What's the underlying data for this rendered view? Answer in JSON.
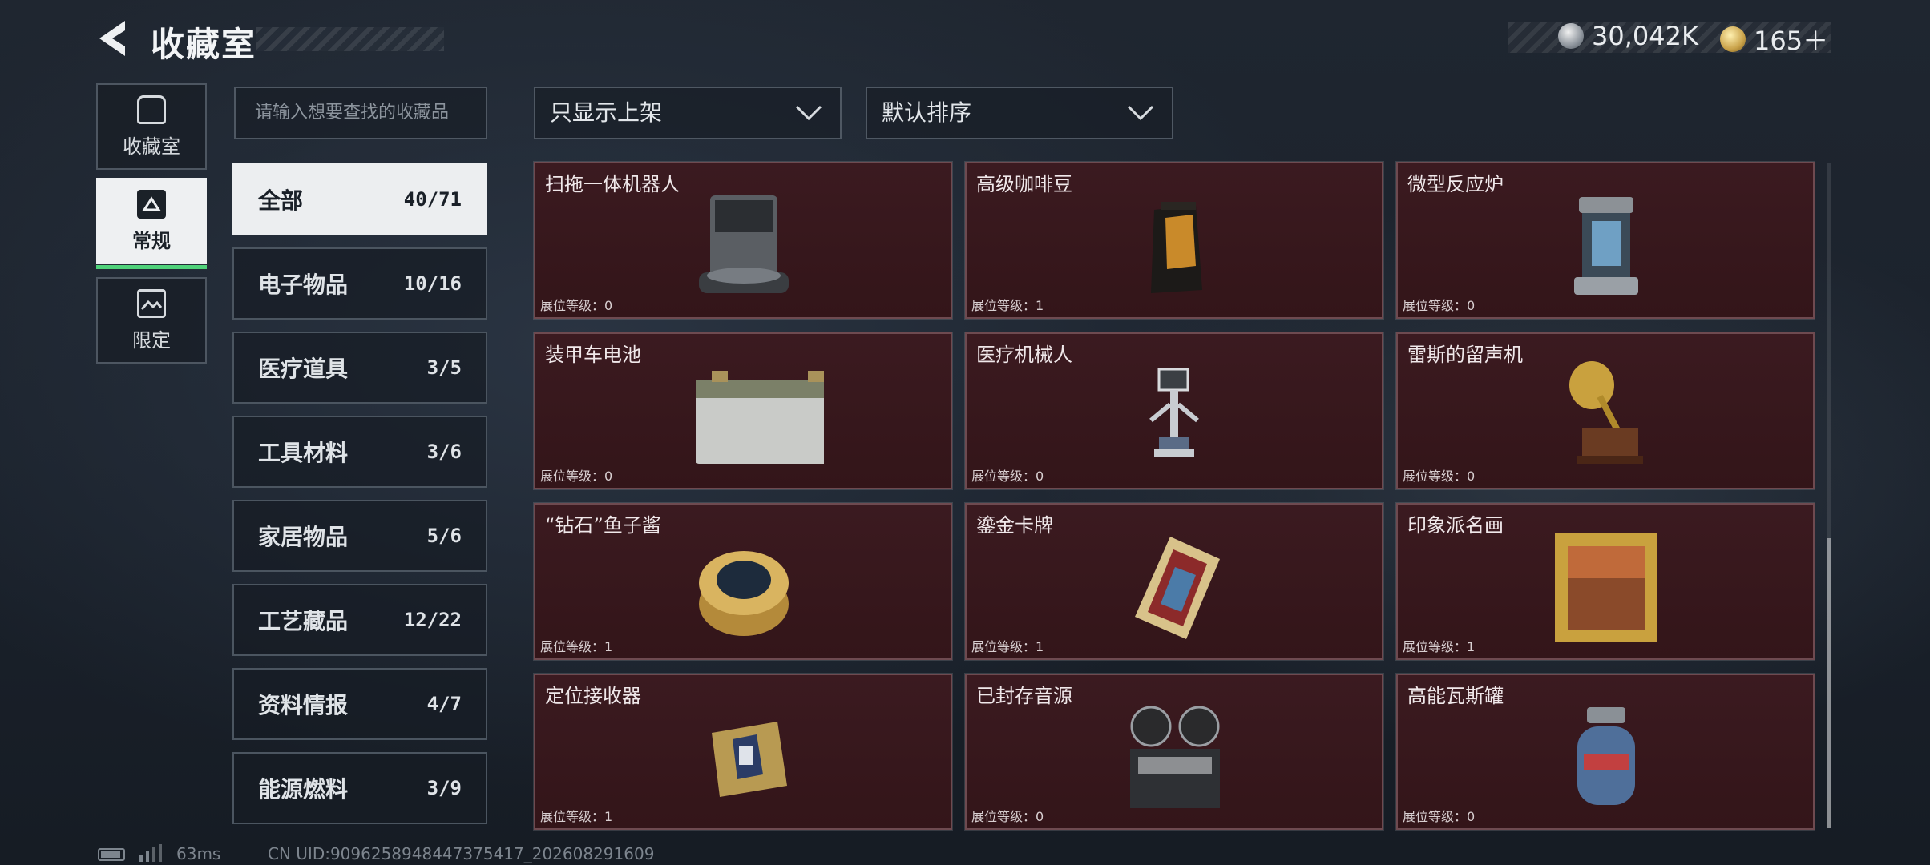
{
  "header": {
    "title": "收藏室",
    "currencies": [
      {
        "icon": "silver-coin-icon",
        "value": "30,042K"
      },
      {
        "icon": "gold-coin-icon",
        "value": "165＋"
      }
    ]
  },
  "side_tabs": [
    {
      "label": "收藏室",
      "icon": "vault-icon",
      "active": false
    },
    {
      "label": "常规",
      "icon": "document-icon",
      "active": true
    },
    {
      "label": "限定",
      "icon": "picture-icon",
      "active": false
    }
  ],
  "search": {
    "placeholder": "请输入想要查找的收藏品"
  },
  "categories": [
    {
      "name": "全部",
      "count": "40/71",
      "active": true
    },
    {
      "name": "电子物品",
      "count": "10/16"
    },
    {
      "name": "医疗道具",
      "count": "3/5"
    },
    {
      "name": "工具材料",
      "count": "3/6"
    },
    {
      "name": "家居物品",
      "count": "5/6"
    },
    {
      "name": "工艺藏品",
      "count": "12/22"
    },
    {
      "name": "资料情报",
      "count": "4/7"
    },
    {
      "name": "能源燃料",
      "count": "3/9"
    }
  ],
  "filters": {
    "filter_label": "只显示上架",
    "sort_label": "默认排序"
  },
  "items": [
    {
      "name": "扫拖一体机器人",
      "level": "展位等级：0",
      "icon": "robot-vacuum-icon"
    },
    {
      "name": "高级咖啡豆",
      "level": "展位等级：1",
      "icon": "coffee-bag-icon"
    },
    {
      "name": "微型反应炉",
      "level": "展位等级：0",
      "icon": "reactor-icon"
    },
    {
      "name": "装甲车电池",
      "level": "展位等级：0",
      "icon": "battery-icon"
    },
    {
      "name": "医疗机械人",
      "level": "展位等级：0",
      "icon": "medical-robot-icon"
    },
    {
      "name": "雷斯的留声机",
      "level": "展位等级：0",
      "icon": "gramophone-icon"
    },
    {
      "name": "“钻石”鱼子酱",
      "level": "展位等级：1",
      "icon": "caviar-tin-icon"
    },
    {
      "name": "鎏金卡牌",
      "level": "展位等级：1",
      "icon": "gold-card-icon"
    },
    {
      "name": "印象派名画",
      "level": "展位等级：1",
      "icon": "framed-painting-icon"
    },
    {
      "name": "定位接收器",
      "level": "展位等级：1",
      "icon": "gps-receiver-icon"
    },
    {
      "name": "已封存音源",
      "level": "展位等级：0",
      "icon": "tape-recorder-icon"
    },
    {
      "name": "高能瓦斯罐",
      "level": "展位等级：0",
      "icon": "gas-canister-icon"
    }
  ],
  "footer": {
    "ping": "63ms",
    "uid": "CN UID:9096258948447375417_202608291609"
  },
  "colors": {
    "card_bg": "#3b1a20",
    "accent_green": "#4fd27a",
    "active_tab": "#eef0f2"
  }
}
